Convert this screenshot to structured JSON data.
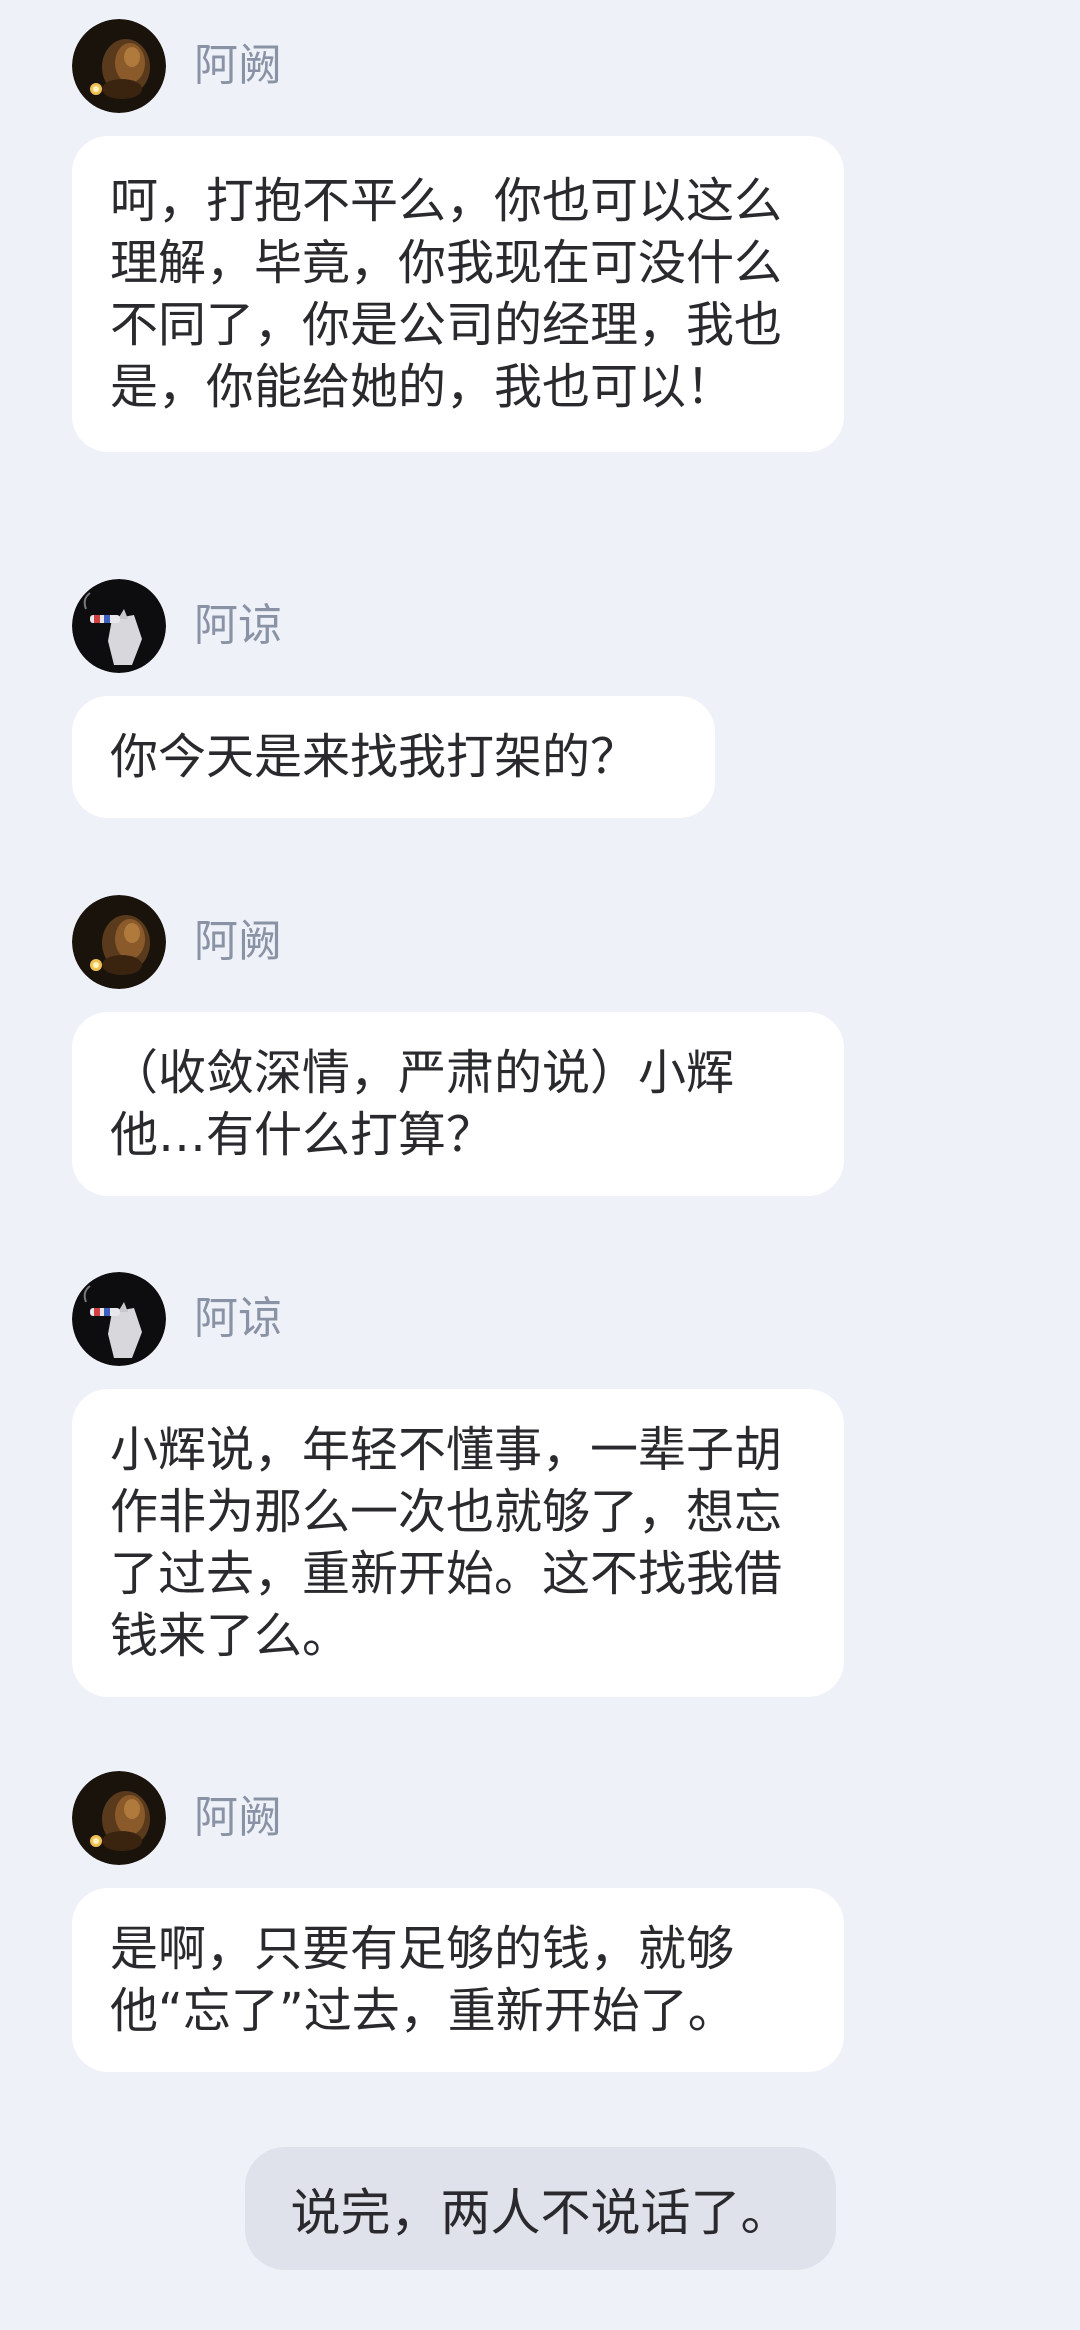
{
  "messages": [
    {
      "speaker": "阿阙",
      "avatar_icon": "candle-portrait-avatar-icon",
      "text": "呵，打抱不平么，你也可以这么理解，毕竟，你我现在可没什么不同了，你是公司的经理，我也是，你能给她的，我也可以！"
    },
    {
      "speaker": "阿谅",
      "avatar_icon": "hand-cigarette-avatar-icon",
      "text": "你今天是来找我打架的？"
    },
    {
      "speaker": "阿阙",
      "avatar_icon": "candle-portrait-avatar-icon",
      "text": "（收敛深情，严肃的说）小辉他…有什么打算？"
    },
    {
      "speaker": "阿谅",
      "avatar_icon": "hand-cigarette-avatar-icon",
      "text": "小辉说，年轻不懂事，一辈子胡作非为那么一次也就够了，想忘了过去，重新开始。这不找我借钱来了么。"
    },
    {
      "speaker": "阿阙",
      "avatar_icon": "candle-portrait-avatar-icon",
      "text": "是啊，只要有足够的钱，就够他“忘了”过去，重新开始了。"
    }
  ],
  "narration": "说完，两人不说话了。",
  "colors": {
    "background": "#eef1f7",
    "bubble": "#ffffff",
    "narration_bubble": "#dfe2ea",
    "name_text": "#8a93a5",
    "body_text": "#2a2a2e"
  }
}
